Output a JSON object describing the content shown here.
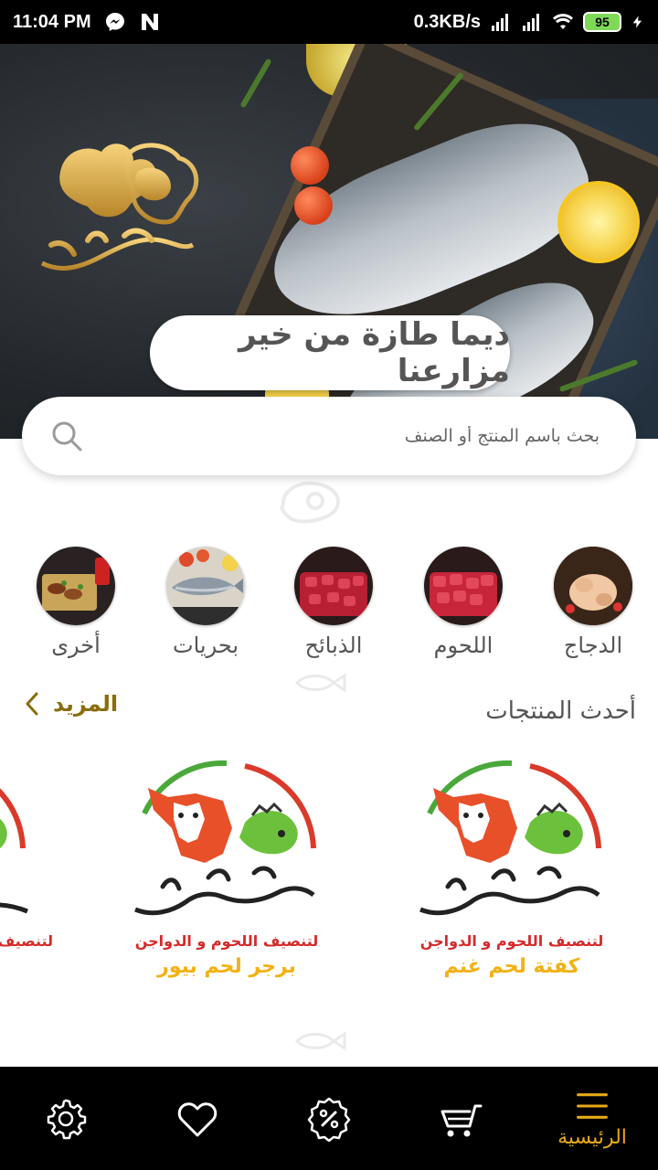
{
  "status_bar": {
    "time": "11:04 PM",
    "network_speed": "0.3KB/s",
    "battery": "95"
  },
  "hero": {
    "tagline": "ديما طازة من خير مزارعنا",
    "brand_name": "زهير النغموش"
  },
  "search": {
    "placeholder": "بحث باسم المنتج أو الصنف"
  },
  "categories": [
    {
      "label": "الدجاج",
      "icon": "chicken-thumb"
    },
    {
      "label": "اللحوم",
      "icon": "meat-thumb"
    },
    {
      "label": "الذبائح",
      "icon": "carcass-thumb"
    },
    {
      "label": "بحريات",
      "icon": "seafood-thumb"
    },
    {
      "label": "أخرى",
      "icon": "other-thumb"
    }
  ],
  "latest": {
    "title": "أحدث المنتجات",
    "more_label": "المزيد",
    "products": [
      {
        "name": "كفتة لحم غنم",
        "logo_text": "زهير النغموش",
        "logo_subtitle": "لتنصيف اللحوم و الدواجن"
      },
      {
        "name": "برجر لحم بيور",
        "logo_text": "زهير النغموش",
        "logo_subtitle": "لتنصيف اللحوم و الدواجن"
      },
      {
        "name": "",
        "logo_text": "",
        "logo_subtitle": "لتنصيف"
      }
    ]
  },
  "bottom_nav": {
    "home_label": "الرئيسية",
    "active": "home",
    "accent": "#e7a916"
  },
  "colors": {
    "accent_gold": "#e7a916",
    "more_link": "#8a6d0c",
    "product_name": "#f3b114"
  }
}
